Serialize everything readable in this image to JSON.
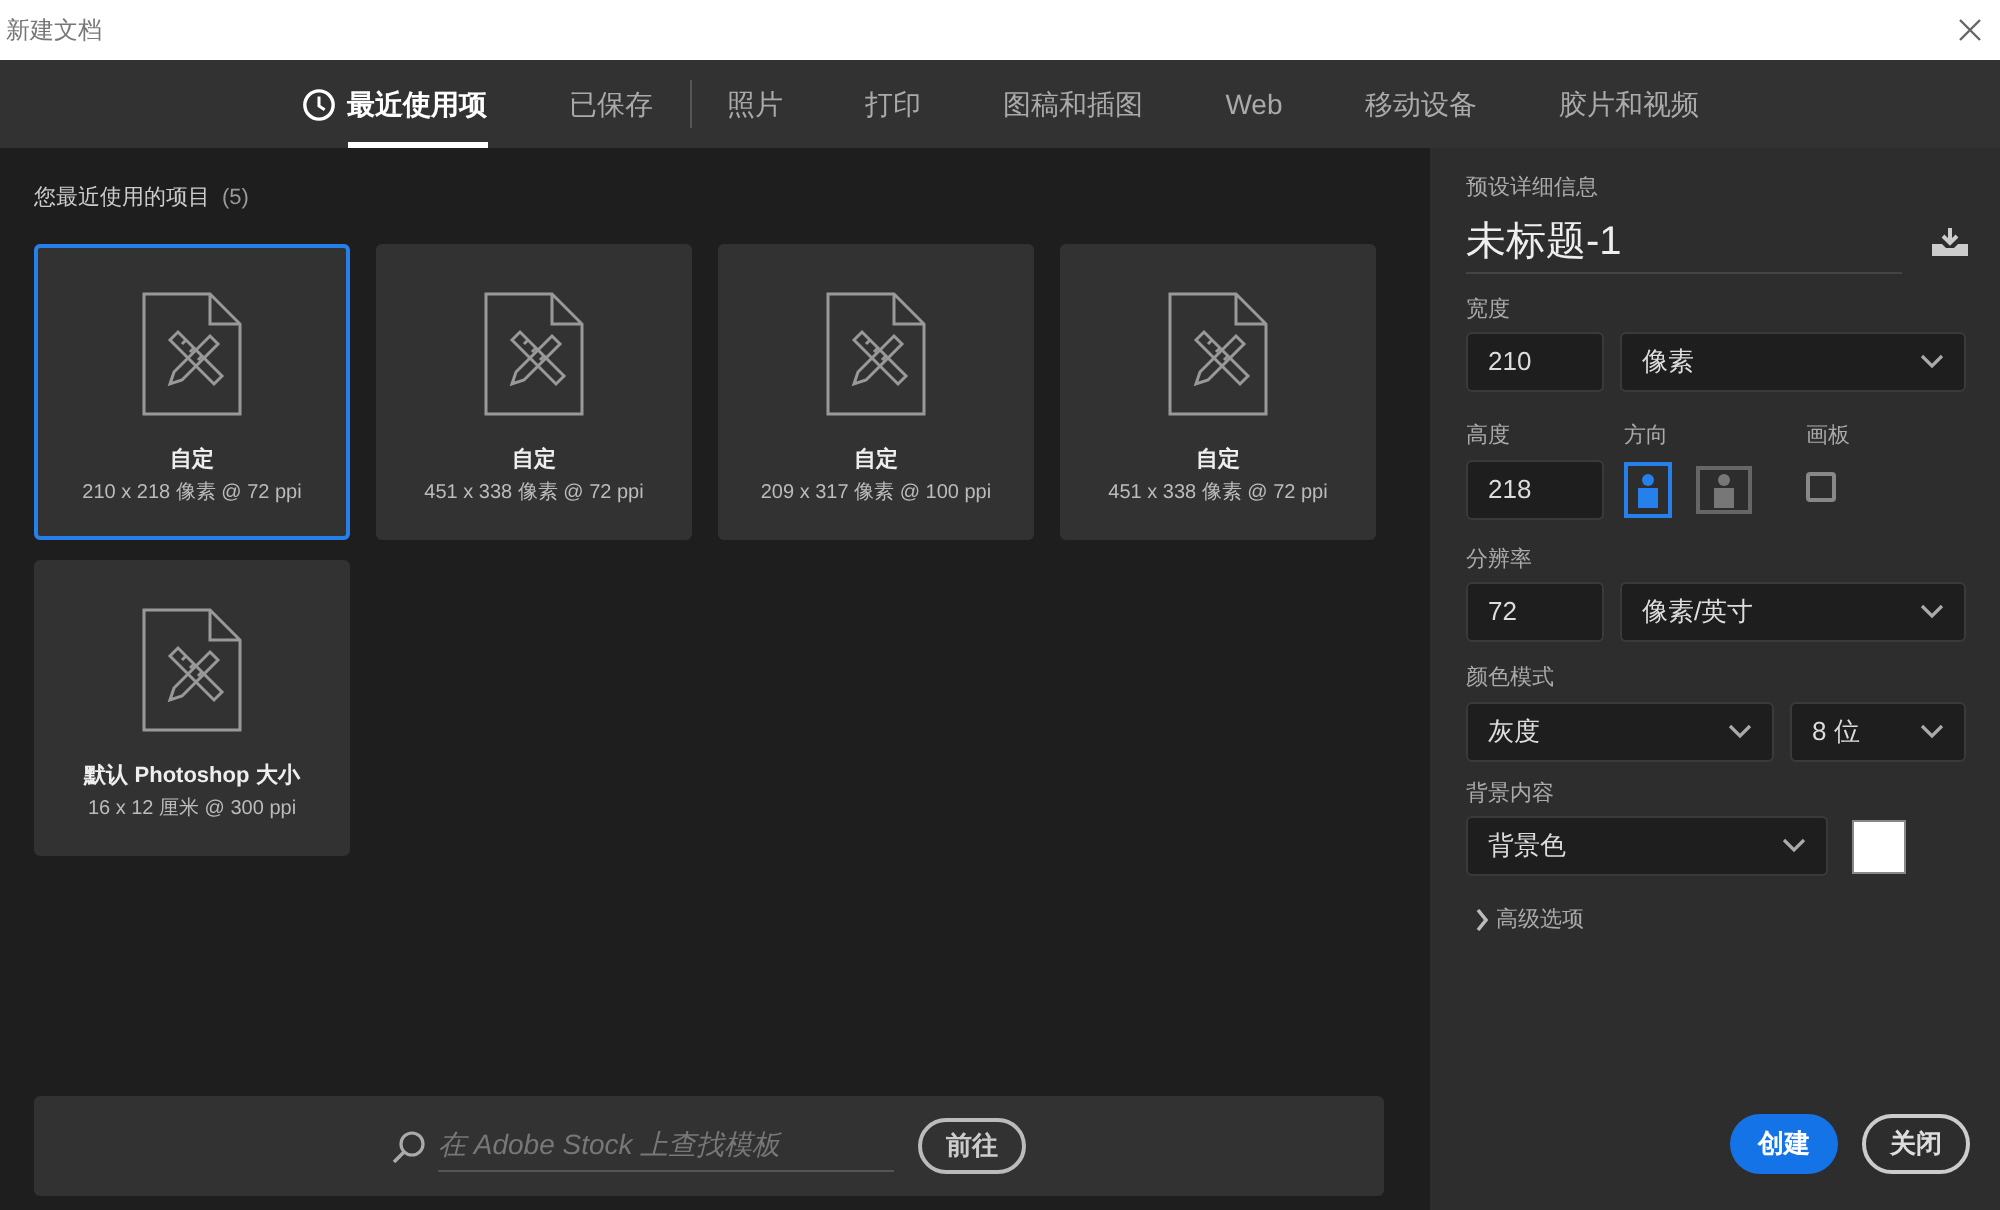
{
  "window": {
    "title": "新建文档"
  },
  "tab_groups": [
    [
      {
        "label": "最近使用项",
        "selected": true,
        "kind": "recent"
      },
      {
        "label": "已保存",
        "selected": false,
        "kind": "plain"
      }
    ],
    [
      {
        "label": "照片",
        "selected": false,
        "kind": "plain"
      },
      {
        "label": "打印",
        "selected": false,
        "kind": "plain"
      },
      {
        "label": "图稿和插图",
        "selected": false,
        "kind": "plain"
      },
      {
        "label": "Web",
        "selected": false,
        "kind": "plain"
      },
      {
        "label": "移动设备",
        "selected": false,
        "kind": "plain"
      },
      {
        "label": "胶片和视频",
        "selected": false,
        "kind": "plain"
      }
    ]
  ],
  "recent": {
    "heading": "您最近使用的项目",
    "count": "(5)",
    "presets": [
      {
        "name": "自定",
        "size": "210 x 218 像素 @ 72 ppi",
        "selected": true
      },
      {
        "name": "自定",
        "size": "451 x 338 像素 @ 72 ppi",
        "selected": false
      },
      {
        "name": "自定",
        "size": "209 x 317 像素 @ 100 ppi",
        "selected": false
      },
      {
        "name": "自定",
        "size": "451 x 338 像素 @ 72 ppi",
        "selected": false
      },
      {
        "name": "默认 Photoshop 大小",
        "size": "16 x 12 厘米 @ 300 ppi",
        "selected": false
      }
    ]
  },
  "search": {
    "placeholder": "在 Adobe Stock 上查找模板",
    "button": "前往"
  },
  "details": {
    "heading": "预设详细信息",
    "title": "未标题-1",
    "width": {
      "label": "宽度",
      "value": "210",
      "unit": "像素"
    },
    "height": {
      "label": "高度",
      "value": "218"
    },
    "orientation": {
      "label": "方向",
      "options": [
        {
          "kind": "portrait",
          "selected": true
        },
        {
          "kind": "landscape",
          "selected": false
        }
      ]
    },
    "artboard": {
      "label": "画板",
      "checked": false
    },
    "resolution": {
      "label": "分辨率",
      "value": "72",
      "unit": "像素/英寸"
    },
    "color_mode": {
      "label": "颜色模式",
      "mode": "灰度",
      "depth": "8 位"
    },
    "background": {
      "label": "背景内容",
      "value": "背景色",
      "color": "#ffffff"
    },
    "advanced": {
      "label": "高级选项",
      "expanded": false
    },
    "buttons": {
      "create": "创建",
      "close": "关闭"
    }
  }
}
